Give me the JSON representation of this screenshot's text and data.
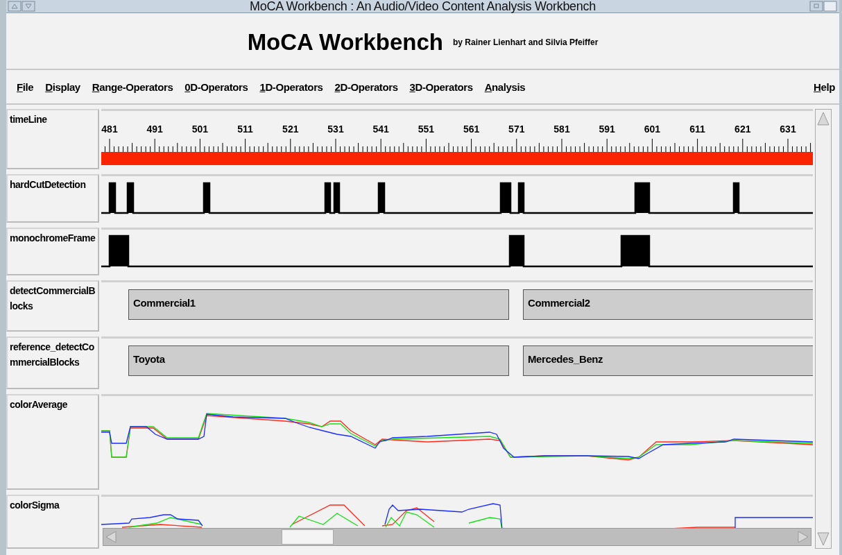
{
  "window": {
    "title": "MoCA Workbench : An Audio/Video Content Analysis Workbench"
  },
  "header": {
    "title": "MoCA Workbench",
    "byline": "by Rainer Lienhart and Silvia Pfeiffer"
  },
  "menu": {
    "items": [
      "File",
      "Display",
      "Range-Operators",
      "0D-Operators",
      "1D-Operators",
      "2D-Operators",
      "3D-Operators",
      "Analysis"
    ],
    "help": "Help"
  },
  "tracks": [
    {
      "label": "timeLine",
      "kind": "timeline",
      "ticks": [
        "481",
        "491",
        "501",
        "511",
        "521",
        "531",
        "541",
        "551",
        "561",
        "571",
        "581",
        "591",
        "601",
        "611",
        "621",
        "631"
      ]
    },
    {
      "label": "hardCutDetection",
      "kind": "cuts"
    },
    {
      "label": "monochromeFrame",
      "kind": "monochrome"
    },
    {
      "label": "detectCommercialBlocks",
      "kind": "blocks",
      "blocks": [
        "Commercial1",
        "Commercial2"
      ]
    },
    {
      "label": "reference_detectCommercialBlocks",
      "kind": "blocks",
      "blocks": [
        "Toyota",
        "Mercedes_Benz"
      ]
    },
    {
      "label": "colorAverage",
      "kind": "color_average"
    },
    {
      "label": "colorSigma",
      "kind": "color_sigma"
    }
  ]
}
